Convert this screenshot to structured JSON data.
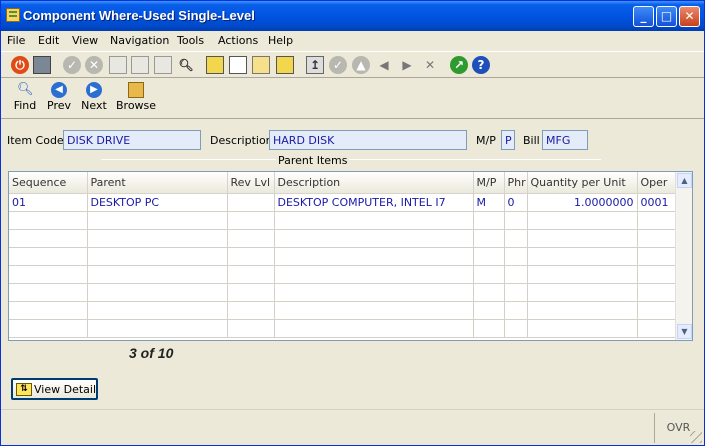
{
  "window": {
    "title": "Component Where-Used Single-Level",
    "minimize": "_",
    "maximize": "□",
    "close": "✕"
  },
  "menu": [
    "File",
    "Edit",
    "View",
    "Navigation",
    "Tools",
    "Actions",
    "Help"
  ],
  "toolbar_icons": [
    "power-icon",
    "window-icon",
    "check-icon",
    "cancel-icon",
    "copy-icon",
    "paste-icon",
    "document-icon",
    "magnifier-icon",
    "clipboard-icon",
    "page-icon",
    "lock-icon",
    "task-icon",
    "up-icon",
    "approve-icon",
    "up-circle-icon",
    "arrow-left-icon",
    "arrow-right-icon",
    "delete-icon",
    "chart-icon",
    "help-icon"
  ],
  "nav": {
    "find": "Find",
    "prev": "Prev",
    "next": "Next",
    "browse": "Browse"
  },
  "form": {
    "item_code_label": "Item Code",
    "item_code": "DISK DRIVE",
    "description_label": "Description",
    "description": "HARD DISK",
    "mp_label": "M/P",
    "mp": "P",
    "bill_label": "Bill",
    "bill": "MFG"
  },
  "parent_items": {
    "title": "Parent Items",
    "columns": [
      "Sequence",
      "Parent",
      "Rev Lvl",
      "Description",
      "M/P",
      "Phr",
      "Quantity per Unit",
      "Oper"
    ],
    "rows": [
      [
        "01",
        "DESKTOP PC",
        "",
        "DESKTOP COMPUTER, INTEL I7",
        "M",
        "0",
        "1.0000000",
        "0001"
      ]
    ]
  },
  "record_counter": "3 of 10",
  "view_detail_label": "View Detail",
  "status": {
    "ovr": "OVR"
  },
  "colors": {
    "titlebar": "#0054e3",
    "field_text": "#1a1aa8",
    "window_bg": "#ece9d8"
  }
}
